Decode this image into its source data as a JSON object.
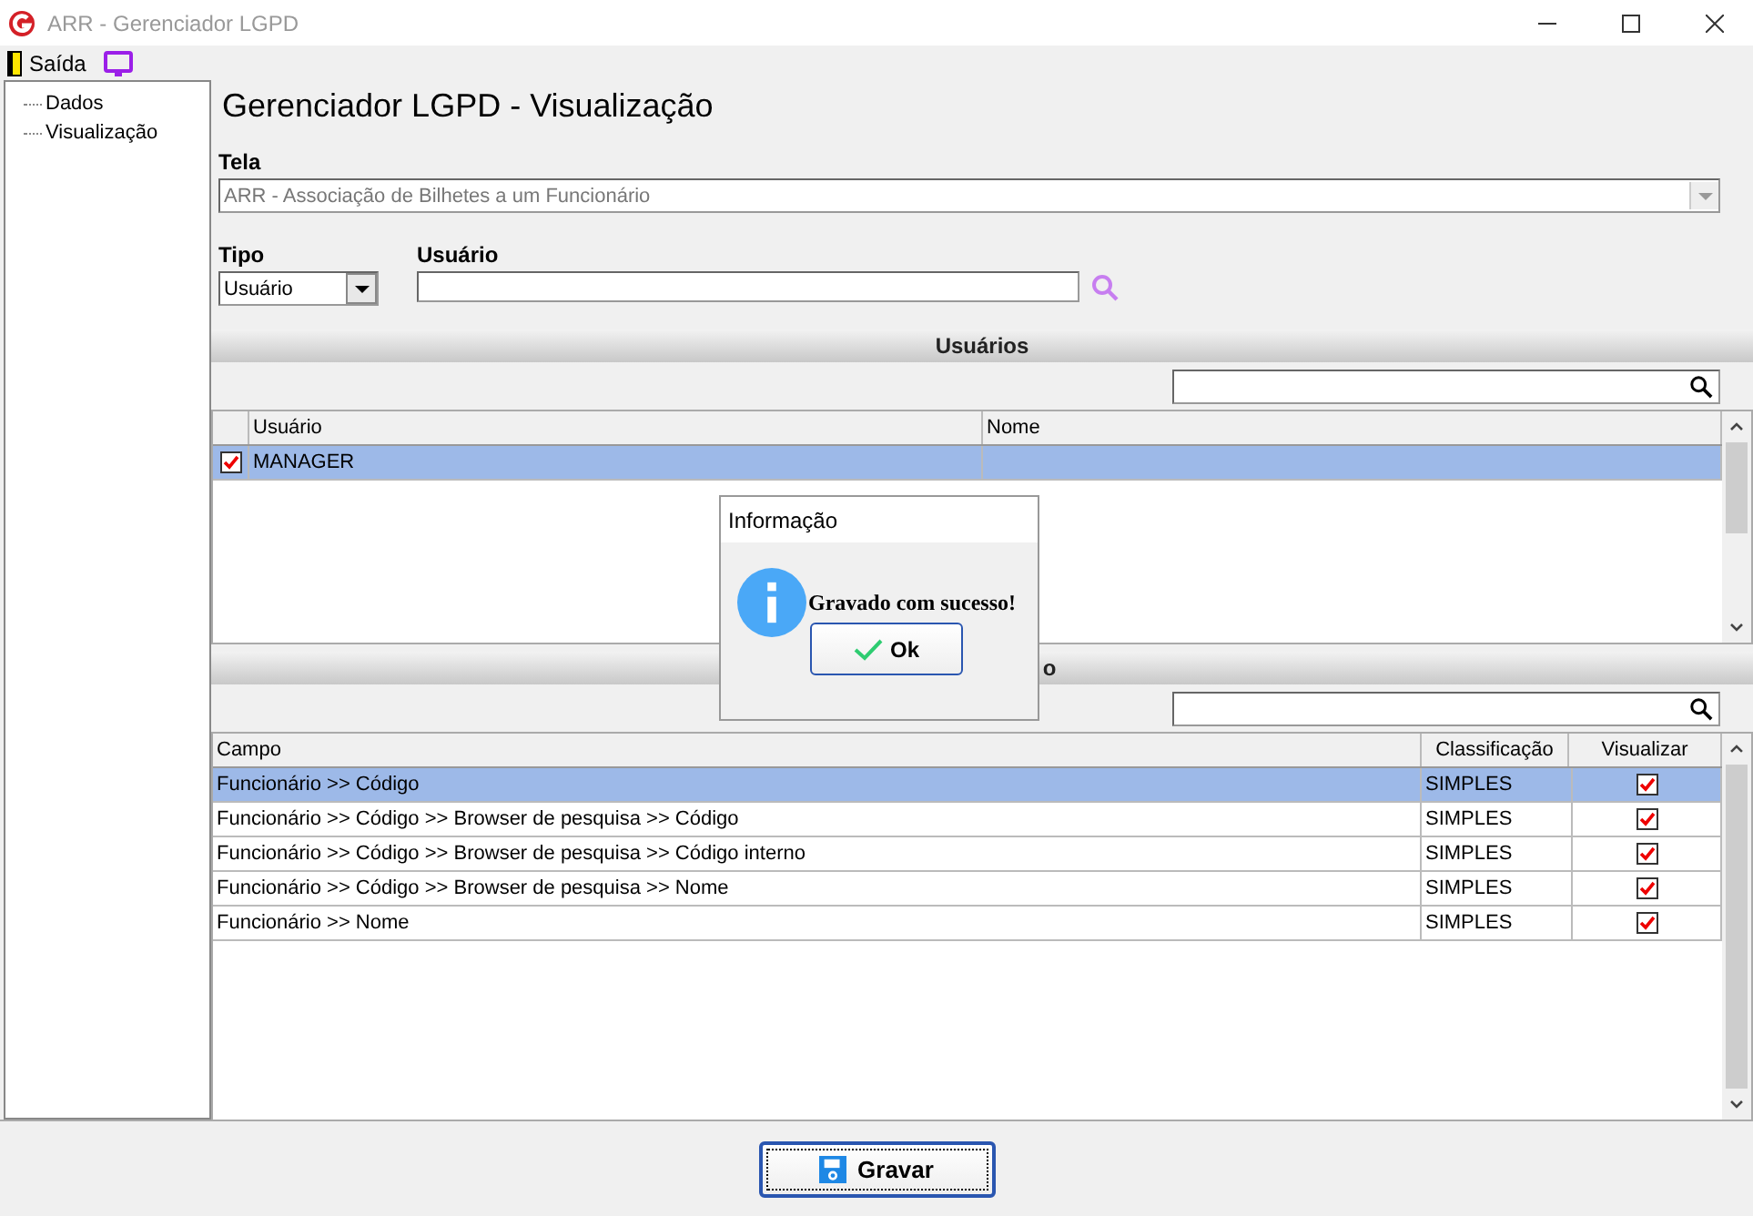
{
  "window": {
    "title": "ARR - Gerenciador LGPD"
  },
  "menu": [
    {
      "label": "Saída",
      "kind": "exit"
    },
    {
      "kind": "screen"
    }
  ],
  "tree": [
    {
      "label": "Dados"
    },
    {
      "label": "Visualização"
    }
  ],
  "heading": "Gerenciador LGPD - Visualização",
  "tela": {
    "label": "Tela",
    "value": "ARR - Associação de Bilhetes a um Funcionário",
    "disabled": true
  },
  "tipo": {
    "label": "Tipo",
    "value": "Usuário"
  },
  "usuario": {
    "label": "Usuário"
  },
  "users_section": {
    "title": "Usuários",
    "columns": [
      "Usuário",
      "Nome"
    ],
    "rows": [
      {
        "checked": true,
        "selected": true,
        "cells": [
          "MANAGER",
          ""
        ]
      }
    ]
  },
  "fields_section": {
    "title": "o",
    "columns": [
      "Campo",
      "Classificação",
      "Visualizar"
    ],
    "rows": [
      {
        "selected": true,
        "campo": "Funcionário >> Código",
        "classificacao": "SIMPLES",
        "visualizar": true
      },
      {
        "selected": false,
        "campo": "Funcionário >> Código >> Browser de pesquisa >> Código",
        "classificacao": "SIMPLES",
        "visualizar": true
      },
      {
        "selected": false,
        "campo": "Funcionário >> Código >> Browser de pesquisa >> Código interno",
        "classificacao": "SIMPLES",
        "visualizar": true
      },
      {
        "selected": false,
        "campo": "Funcionário >> Código >> Browser de pesquisa >> Nome",
        "classificacao": "SIMPLES",
        "visualizar": true
      },
      {
        "selected": false,
        "campo": "Funcionário >> Nome",
        "classificacao": "SIMPLES",
        "visualizar": true
      }
    ]
  },
  "dialog": {
    "title": "Informação",
    "message": "Gravado com sucesso!",
    "button": "Ok"
  },
  "save_button": "Gravar"
}
